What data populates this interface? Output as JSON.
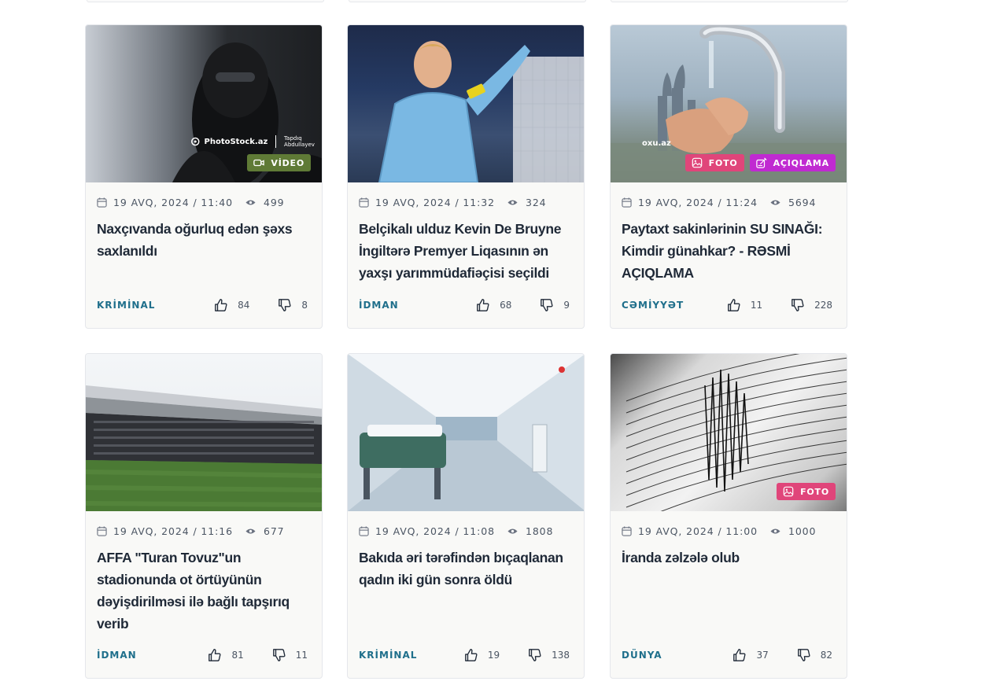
{
  "cards": [
    {
      "date": "19 AVQ, 2024 / 11:40",
      "views": "499",
      "title": "Naxçıvanda oğurluq edən şəxs saxlanıldı",
      "category": "KRİMİNAL",
      "likes": "84",
      "dislikes": "8",
      "badges": [
        "VİDEO"
      ],
      "watermark": {
        "brand": "PhotoStock.az",
        "credit": "Tapdıq Abdullayev"
      }
    },
    {
      "date": "19 AVQ, 2024 / 11:32",
      "views": "324",
      "title": "Belçikalı ulduz Kevin De Bruyne İngiltərə Premyer Liqasının ən yaxşı yarımmüdafiəçisi seçildi",
      "category": "İDMAN",
      "likes": "68",
      "dislikes": "9",
      "badges": []
    },
    {
      "date": "19 AVQ, 2024 / 11:24",
      "views": "5694",
      "title": "Paytaxt sakinlərinin SU SINAĞI: Kimdir günahkar? - RƏSMİ AÇIQLAMA",
      "category": "CƏMİYYƏT",
      "likes": "11",
      "dislikes": "228",
      "badges": [
        "FOTO",
        "AÇIQLAMA"
      ],
      "watermark": {
        "brand": "oxu.az"
      }
    },
    {
      "date": "19 AVQ, 2024 / 11:16",
      "views": "677",
      "title": "AFFA \"Turan Tovuz\"un stadionunda ot örtüyünün dəyişdirilməsi ilə bağlı tapşırıq verib",
      "category": "İDMAN",
      "likes": "81",
      "dislikes": "11",
      "badges": []
    },
    {
      "date": "19 AVQ, 2024 / 11:08",
      "views": "1808",
      "title": "Bakıda əri tərəfindən bıçaqlanan qadın iki gün sonra öldü",
      "category": "KRİMİNAL",
      "likes": "19",
      "dislikes": "138",
      "badges": []
    },
    {
      "date": "19 AVQ, 2024 / 11:00",
      "views": "1000",
      "title": "İranda zəlzələ olub",
      "category": "DÜNYA",
      "likes": "37",
      "dislikes": "82",
      "badges": [
        "FOTO"
      ]
    }
  ],
  "colors": {
    "category": "#1f6f8b",
    "video_badge": "#5f7a36",
    "foto_badge": "#e0457a",
    "aciqlama_badge": "#c02ad1"
  }
}
